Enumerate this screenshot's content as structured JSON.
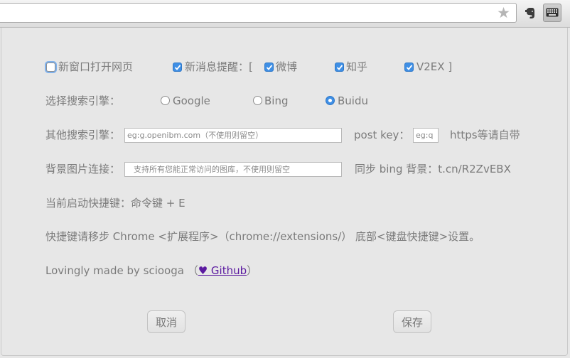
{
  "browser": {
    "star_glyph": "★",
    "extensions": [
      {
        "icon": "evernote-elephant-icon"
      },
      {
        "icon": "keyboard-icon",
        "active": true
      }
    ]
  },
  "options": {
    "open_new_window": {
      "label": "新窗口打开网页",
      "checked": false
    },
    "notify": {
      "label": "新消息提醒：[",
      "checked": true,
      "sources": [
        {
          "label": "微博",
          "checked": true
        },
        {
          "label": "知乎",
          "checked": true
        },
        {
          "label": "V2EX ]",
          "checked": true
        }
      ]
    },
    "search_engine": {
      "label": "选择搜索引擎：",
      "choices": [
        {
          "label": "Google",
          "selected": false
        },
        {
          "label": "Bing",
          "selected": false
        },
        {
          "label": "Buidu",
          "selected": true
        }
      ]
    },
    "other_engine": {
      "label": "其他搜索引擎：",
      "placeholder": "eg:g.openibm.com（不使用则留空）",
      "post_key_label": "post  key：",
      "post_key_placeholder": "eg:q",
      "https_note": "https等请自带"
    },
    "background": {
      "label": "背景图片连接：",
      "placeholder": "支持所有您能正常访问的图库，不使用则留空",
      "bing_sync": "同步 bing 背景：t.cn/R2ZvEBX"
    },
    "shortcut": {
      "text": "当前启动快捷键：命令键 + E"
    },
    "shortcut_hint": {
      "text": "快捷键请移步 Chrome <扩展程序>（chrome://extensions/） 底部<键盘快捷键>设置。"
    },
    "footer": {
      "text": "Lovingly made by sciooga （",
      "link": "♥ Github",
      "close": "）"
    },
    "colors": {
      "accent": "#3f8fe5",
      "text": "#7b7b7b",
      "link": "#5b1aa0",
      "background": "#e7e7e7"
    }
  },
  "actions": {
    "cancel": "取消",
    "save": "保存"
  }
}
